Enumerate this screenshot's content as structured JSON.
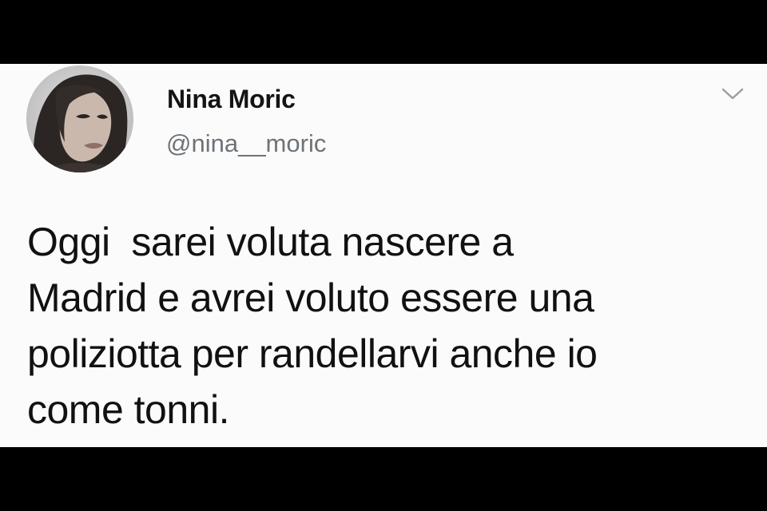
{
  "tweet": {
    "author": {
      "display_name": "Nina Moric",
      "handle": "@nina__moric",
      "avatar_icon": "profile-photo"
    },
    "menu_icon": "chevron-down-icon",
    "text_lines": [
      "Oggi  sarei voluta nascere a",
      "Madrid e avrei voluto essere una",
      "poliziotta per randellarvi anche io",
      "come tonni."
    ]
  },
  "colors": {
    "letterbox": "#000000",
    "card_background": "#fbfbfb",
    "text": "#141414",
    "handle": "#6e7378",
    "chevron": "#9aa0a6"
  }
}
